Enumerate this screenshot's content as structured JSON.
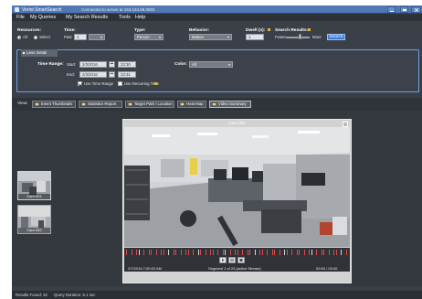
{
  "app": {
    "title": "Verint SmartSearch",
    "connection": "Connected to server at 153.134.69.0003"
  },
  "menu": [
    "File",
    "My Queries",
    "My Search Results",
    "Tools",
    "Help"
  ],
  "search": {
    "resources_label": "Resources:",
    "resources_all": "All",
    "resources_select": "Select",
    "time_label": "Time:",
    "time_mode": "Past",
    "time_value": "1",
    "type_label": "Type:",
    "type_value": "Person",
    "behavior_label": "Behavior:",
    "behavior_value": "Motion",
    "dwell_label": "Dwell (s):",
    "dwell_value": "1",
    "results_label": "Search Results:",
    "results_fewer": "Fewer",
    "results_more": "More",
    "search_button": "Search"
  },
  "timerange": {
    "tab_label": "Less Detail",
    "time_range_label": "Time Range:",
    "start_label": "Start:",
    "start_date": "2/3/2016",
    "start_time": "23:30",
    "end_label": "End:",
    "end_date": "2/3/2016",
    "end_time": "23:31",
    "use_time_range": "Use Time Range",
    "use_recurring": "Use Recurring Time",
    "color_label": "Color:",
    "color_value": "All"
  },
  "view": {
    "label": "View:",
    "tabs": [
      "Event Thumbnails",
      "Statistics Report",
      "Target Path / Location",
      "Heat Map",
      "Video Summary"
    ]
  },
  "thumbnails": [
    {
      "caption": "Cam 001"
    },
    {
      "caption": "Cam 002"
    }
  ],
  "video": {
    "title": "Cam 001",
    "start_time": "2/7/2016 7:00:02 AM",
    "segment": "Segment 1 of 23 (active Stream)",
    "end_time": "00:00 / 00:00"
  },
  "status": {
    "results_found": "Results Found: 32",
    "query_duration": "Query Duration: 5.1 sec"
  },
  "colors": {
    "titlebar": "#4f78b5",
    "panel": "#3b4048",
    "accent": "#3d7bd9",
    "timeline_marker": "#d94b4b"
  }
}
